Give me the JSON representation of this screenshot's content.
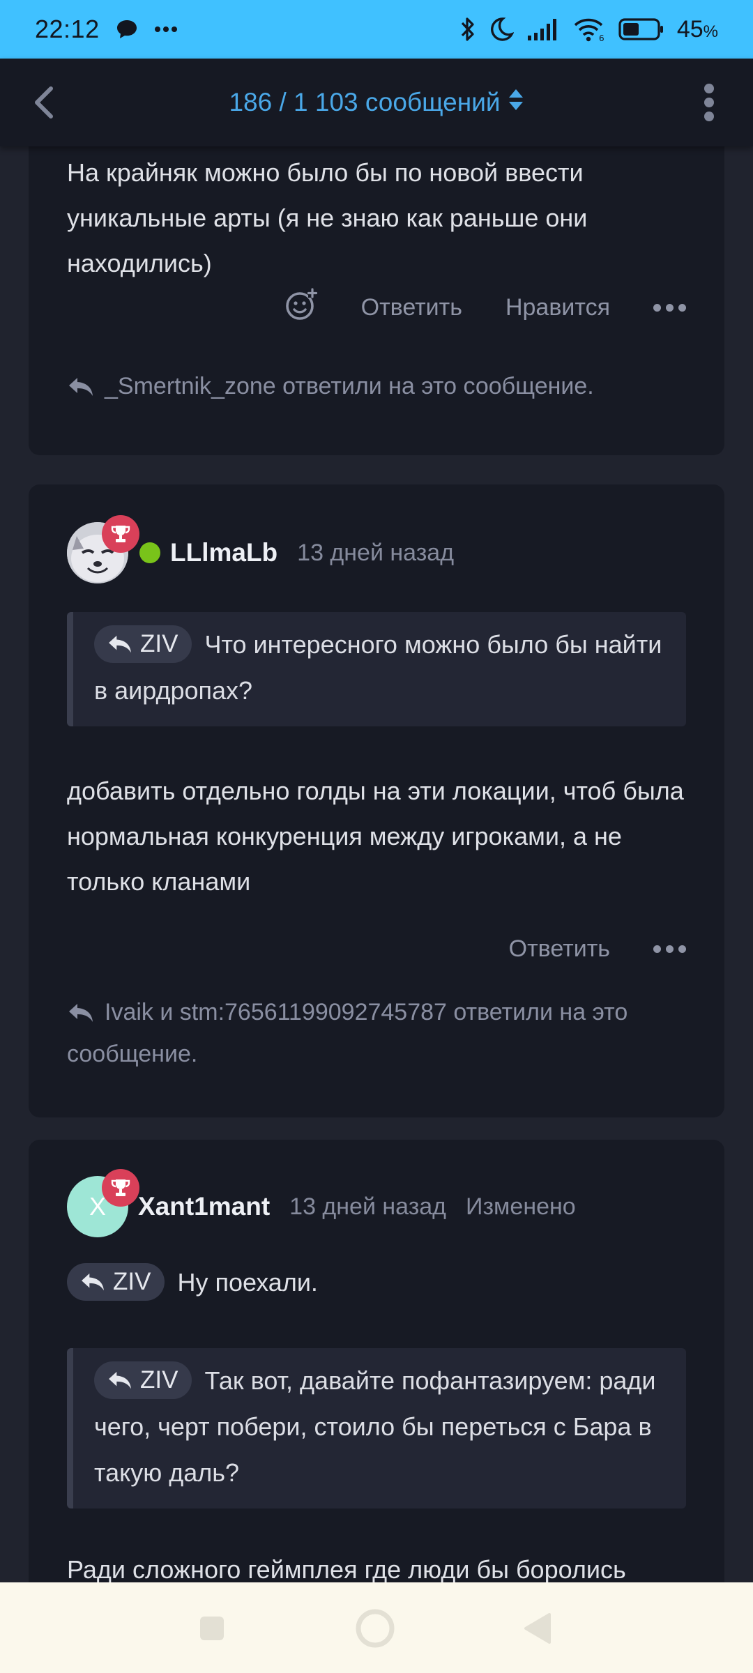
{
  "status_bar": {
    "time": "22:12",
    "battery_percent": "45",
    "battery_unit": "%",
    "icons": [
      "chat-bubble-icon",
      "more-dots-icon",
      "bluetooth-icon",
      "moon-icon",
      "signal-icon",
      "wifi-icon",
      "battery-icon"
    ]
  },
  "app_bar": {
    "title": "186 / 1 103 сообщений",
    "icons": [
      "back-chevron-icon",
      "sort-arrows-icon",
      "overflow-menu-icon"
    ]
  },
  "posts": [
    {
      "body": "На крайняк можно было бы по новой ввести уникальные арты (я не знаю как раньше они находились)",
      "actions": {
        "reply": "Ответить",
        "like": "Нравится"
      },
      "replied_by": "_Smertnik_zone ответили на это сообщение."
    },
    {
      "author": "LLlmaLb",
      "time": "13 дней назад",
      "quote": {
        "user": "ZIV",
        "text": "Что интересного можно было бы найти в аирдропах?"
      },
      "body": "добавить отдельно голды на эти локации, чтоб была нормальная конкуренция между игроками, а не только кланами",
      "actions": {
        "reply": "Ответить"
      },
      "replied_by": "Ivaik и stm:76561199092745787 ответили на это сообщение."
    },
    {
      "author": "Xant1mant",
      "avatar_letter": "X",
      "time": "13 дней назад",
      "edited": "Изменено",
      "inline_reply": {
        "user": "ZIV",
        "text": "Ну поехали."
      },
      "quote": {
        "user": "ZIV",
        "text": "Так вот, давайте пофантазируем: ради чего, черт побери, стоило бы переться с Бара в такую даль?"
      },
      "body": "Ради сложного геймплея где люди бы боролись"
    }
  ],
  "colors": {
    "status_bar": "#40c1ff",
    "app_bar": "#161923",
    "background": "#20232e",
    "card": "#171a24",
    "accent": "#4aa8e8",
    "online": "#79c31a",
    "trophy_badge": "#d94059",
    "avatar_x": "#9ee6d6",
    "nav_bar": "#fbf8ec"
  }
}
